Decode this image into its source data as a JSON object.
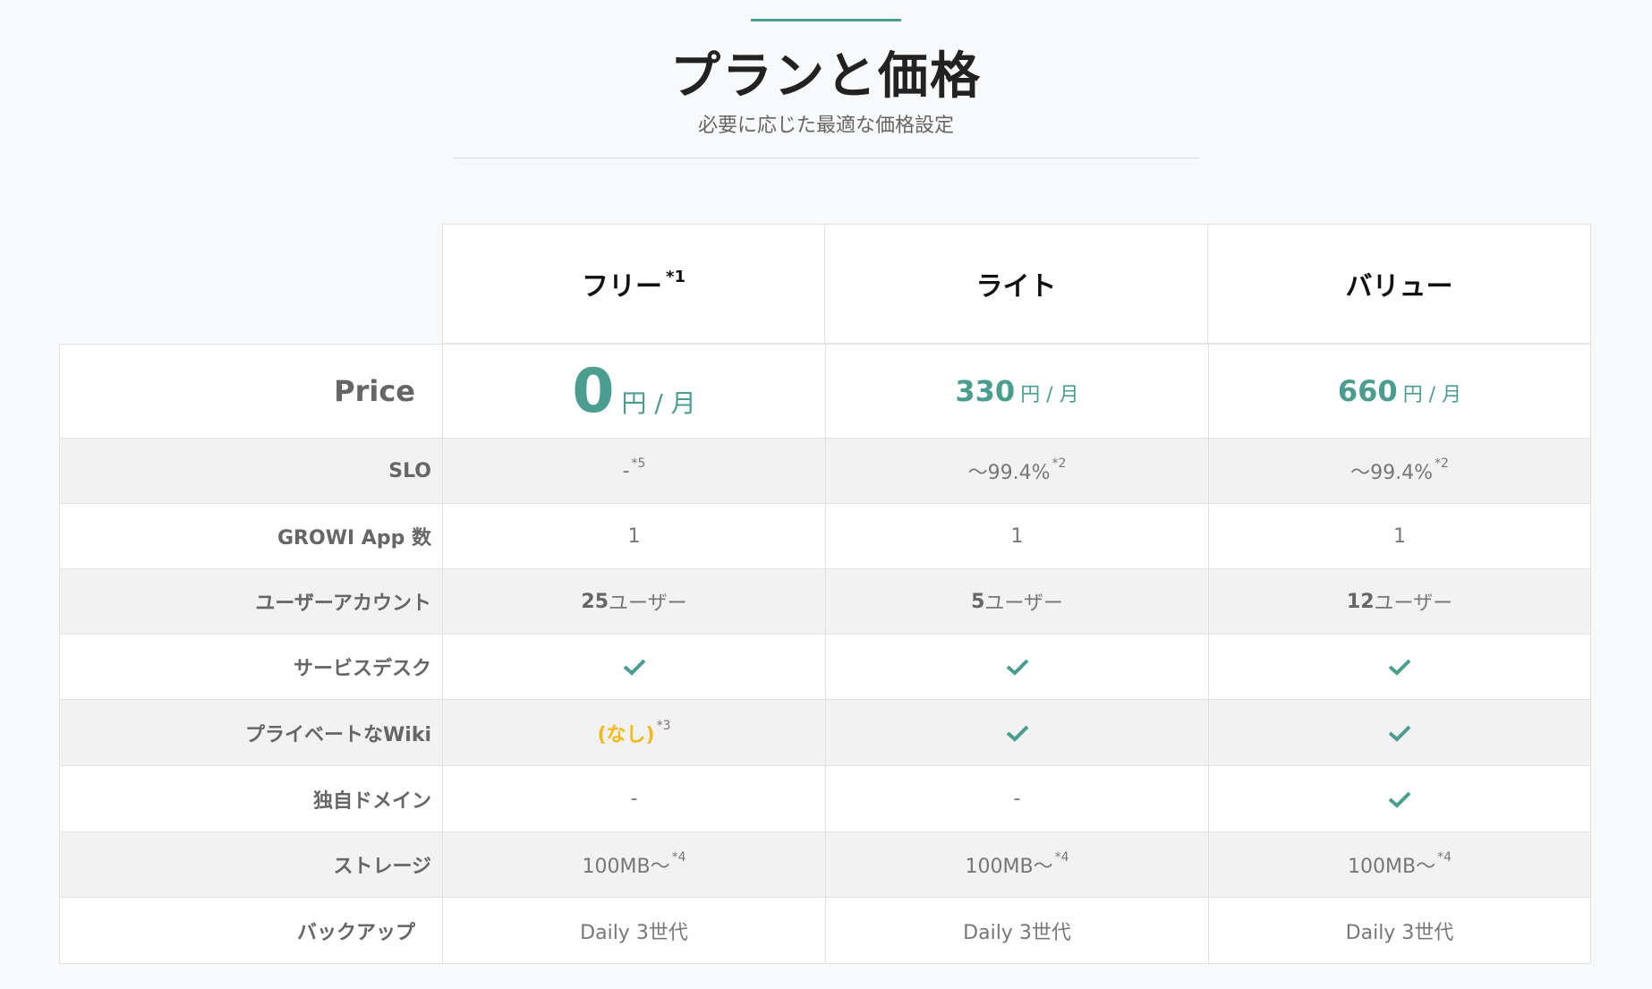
{
  "header": {
    "title": "プランと価格",
    "subtitle": "必要に応じた最適な価格設定"
  },
  "plans": [
    {
      "name": "フリー",
      "note": "*1"
    },
    {
      "name": "ライト",
      "note": ""
    },
    {
      "name": "バリュー",
      "note": ""
    }
  ],
  "price": {
    "label": "Price",
    "unit": "円 / 月",
    "values": [
      "0",
      "330",
      "660"
    ]
  },
  "rows": {
    "slo": {
      "label": "SLO",
      "values": [
        "-",
        "～99.4%",
        "～99.4%"
      ],
      "notes": [
        "*5",
        "*2",
        "*2"
      ]
    },
    "apps": {
      "label": "GROWI App 数",
      "values": [
        "1",
        "1",
        "1"
      ]
    },
    "users": {
      "label": "ユーザーアカウント",
      "nums": [
        "25",
        "5",
        "12"
      ],
      "suffix": "ユーザー"
    },
    "service_desk": {
      "label": "サービスデスク"
    },
    "private_wiki": {
      "label": "プライベートなWiki",
      "free_value": "(なし)",
      "free_note": "*3"
    },
    "domain": {
      "label": "独自ドメイン",
      "values": [
        "-",
        "-"
      ]
    },
    "storage": {
      "label": "ストレージ",
      "value": "100MB～",
      "note": "*4"
    },
    "backup": {
      "label": "バックアップ",
      "value": "Daily 3世代"
    }
  },
  "colors": {
    "accent": "#4a9d8f",
    "warning": "#f2b81c"
  },
  "icons": {
    "included": "check-icon"
  }
}
